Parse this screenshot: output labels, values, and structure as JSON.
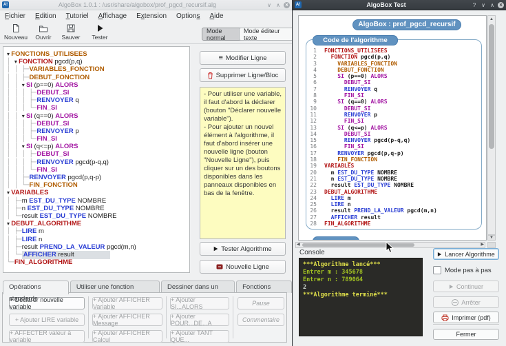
{
  "colors": {
    "kw": {
      "o": "#b05c00",
      "r": "#b21515",
      "p": "#a317a3",
      "b": "#2b3fd4",
      "k": "#1c1c1c"
    },
    "console": {
      "y": "#dede4a",
      "g": "#a3c322",
      "w": "#c4ccc4"
    },
    "badge_blue": "#6092c0",
    "console_bg": "#2a2a27",
    "selection": "#dbdfe3"
  },
  "left_window": {
    "title": "AlgoBox 1.0.1 : /usr/share/algobox/prof_pgcd_recursif.alg",
    "menus": [
      {
        "label": "Fichier",
        "u": 0
      },
      {
        "label": "Edition",
        "u": 0
      },
      {
        "label": "Tutoriel",
        "u": 0
      },
      {
        "label": "Affichage",
        "u": 0
      },
      {
        "label": "Extension",
        "u": 1
      },
      {
        "label": "Options",
        "u": 6
      },
      {
        "label": "Aide",
        "u": 0
      }
    ],
    "toolbar": {
      "items": [
        "Nouveau",
        "Ouvrir",
        "Sauver",
        "Tester"
      ],
      "mode_normal": "Mode normal",
      "mode_editor": "Mode éditeur texte"
    },
    "tree": {
      "items": [
        {
          "pre": "",
          "c": "a",
          "seg": [
            [
              "FONCTIONS_UTILISEES",
              "o"
            ]
          ]
        },
        {
          "pre": "│ ",
          "c": "a",
          "seg": [
            [
              "FONCTION",
              "r"
            ],
            [
              " pgcd(p,q)",
              "k"
            ]
          ]
        },
        {
          "pre": "│ │ ",
          "c": "t",
          "seg": [
            [
              "VARIABLES_FONCTION",
              "o"
            ]
          ]
        },
        {
          "pre": "│ │ ",
          "c": "t",
          "seg": [
            [
              "DEBUT_FONCTION",
              "o"
            ]
          ]
        },
        {
          "pre": "│ │ ",
          "c": "a",
          "seg": [
            [
              "SI",
              "p"
            ],
            [
              " (p==0) ",
              "k"
            ],
            [
              "ALORS",
              "p"
            ]
          ]
        },
        {
          "pre": "│ │ │ ",
          "c": "t",
          "seg": [
            [
              "DEBUT_SI",
              "p"
            ]
          ]
        },
        {
          "pre": "│ │ │ ",
          "c": "t",
          "seg": [
            [
              "RENVOYER",
              "b"
            ],
            [
              " q",
              "k"
            ]
          ]
        },
        {
          "pre": "│ │ │ ",
          "c": "l",
          "seg": [
            [
              "FIN_SI",
              "p"
            ]
          ]
        },
        {
          "pre": "│ │ ",
          "c": "a",
          "seg": [
            [
              "SI",
              "p"
            ],
            [
              " (q==0) ",
              "k"
            ],
            [
              "ALORS",
              "p"
            ]
          ]
        },
        {
          "pre": "│ │ │ ",
          "c": "t",
          "seg": [
            [
              "DEBUT_SI",
              "p"
            ]
          ]
        },
        {
          "pre": "│ │ │ ",
          "c": "t",
          "seg": [
            [
              "RENVOYER",
              "b"
            ],
            [
              " p",
              "k"
            ]
          ]
        },
        {
          "pre": "│ │ │ ",
          "c": "l",
          "seg": [
            [
              "FIN_SI",
              "p"
            ]
          ]
        },
        {
          "pre": "│ │ ",
          "c": "a",
          "seg": [
            [
              "SI",
              "p"
            ],
            [
              " (q<=p) ",
              "k"
            ],
            [
              "ALORS",
              "p"
            ]
          ]
        },
        {
          "pre": "│ │ │ ",
          "c": "t",
          "seg": [
            [
              "DEBUT_SI",
              "p"
            ]
          ]
        },
        {
          "pre": "│ │ │ ",
          "c": "t",
          "seg": [
            [
              "RENVOYER",
              "b"
            ],
            [
              " pgcd(p-q,q)",
              "k"
            ]
          ]
        },
        {
          "pre": "│ │ │ ",
          "c": "l",
          "seg": [
            [
              "FIN_SI",
              "p"
            ]
          ]
        },
        {
          "pre": "│ │ ",
          "c": "t",
          "seg": [
            [
              "RENVOYER",
              "b"
            ],
            [
              " pgcd(p,q-p)",
              "k"
            ]
          ]
        },
        {
          "pre": "│ │ ",
          "c": "l",
          "seg": [
            [
              "FIN_FONCTION",
              "o"
            ]
          ]
        },
        {
          "pre": "",
          "c": "a",
          "seg": [
            [
              "VARIABLES",
              "r"
            ]
          ]
        },
        {
          "pre": "│ ",
          "c": "t",
          "seg": [
            [
              "m ",
              "k"
            ],
            [
              "EST_DU_TYPE",
              "b"
            ],
            [
              " NOMBRE",
              "k"
            ]
          ]
        },
        {
          "pre": "│ ",
          "c": "t",
          "seg": [
            [
              "n ",
              "k"
            ],
            [
              "EST_DU_TYPE",
              "b"
            ],
            [
              " NOMBRE",
              "k"
            ]
          ]
        },
        {
          "pre": "│ ",
          "c": "l",
          "seg": [
            [
              "result ",
              "k"
            ],
            [
              "EST_DU_TYPE",
              "b"
            ],
            [
              " NOMBRE",
              "k"
            ]
          ]
        },
        {
          "pre": "",
          "c": "a",
          "seg": [
            [
              "DEBUT_ALGORITHME",
              "r"
            ]
          ]
        },
        {
          "pre": "│ ",
          "c": "t",
          "seg": [
            [
              "LIRE",
              "b"
            ],
            [
              " m",
              "k"
            ]
          ]
        },
        {
          "pre": "│ ",
          "c": "t",
          "seg": [
            [
              "LIRE",
              "b"
            ],
            [
              " n",
              "k"
            ]
          ]
        },
        {
          "pre": "│ ",
          "c": "t",
          "seg": [
            [
              "result ",
              "k"
            ],
            [
              "PREND_LA_VALEUR",
              "b"
            ],
            [
              " pgcd(m,n)",
              "k"
            ]
          ]
        },
        {
          "pre": "│ ",
          "c": "l",
          "seg": [
            [
              "AFFICHER",
              "b"
            ],
            [
              " result",
              "k"
            ]
          ],
          "sel": true
        },
        {
          "pre": "",
          "c": "l",
          "seg": [
            [
              "FIN_ALGORITHME",
              "r"
            ]
          ]
        }
      ]
    },
    "middle": {
      "modify": "Modifier Ligne",
      "delete": "Supprimer Ligne/Bloc",
      "note": "- Pour utiliser une variable, il faut d'abord la déclarer (bouton \"Déclarer nouvelle variable\").\n- Pour ajouter un nouvel élément à l'algorithme, il faut d'abord insérer une nouvelle ligne (bouton \"Nouvelle Ligne\"), puis cliquer sur un des boutons disponibles dans les panneaux disponibles en bas de la fenêtre.",
      "test": "Tester Algorithme",
      "newline": "Nouvelle Ligne"
    },
    "tabs": [
      "Opérations standards",
      "Utiliser une fonction numérique",
      "Dessiner dans un repère",
      "Fonctions locales"
    ],
    "ops": {
      "col1": [
        "+ Déclarer nouvelle variable",
        "+ Ajouter LIRE variable",
        "+ AFFECTER valeur à variable"
      ],
      "col2": [
        "+ Ajouter AFFICHER Variable",
        "+ Ajouter AFFICHER Message",
        "+ Ajouter AFFICHER Calcul"
      ],
      "col3": [
        "+ Ajouter SI...ALORS",
        "+ Ajouter POUR...DE...A",
        "+ Ajouter TANT QUE..."
      ],
      "col4": [
        "Pause",
        "Commentaire"
      ]
    }
  },
  "right_window": {
    "title": "AlgoBox Test",
    "badge": "AlgoBox : prof_pgcd_recursif",
    "code_badge": "Code de l'algorithme",
    "code": {
      "lines": [
        {
          "n": 1,
          "i": 0,
          "seg": [
            [
              "FONCTIONS_UTILISEES",
              "r"
            ]
          ]
        },
        {
          "n": 2,
          "i": 2,
          "seg": [
            [
              "FONCTION",
              "r"
            ],
            [
              " pgcd(p,q)",
              "k"
            ]
          ]
        },
        {
          "n": 3,
          "i": 4,
          "seg": [
            [
              "VARIABLES_FONCTION",
              "o"
            ]
          ]
        },
        {
          "n": 4,
          "i": 4,
          "seg": [
            [
              "DEBUT_FONCTION",
              "o"
            ]
          ]
        },
        {
          "n": 5,
          "i": 4,
          "seg": [
            [
              "SI",
              "p"
            ],
            [
              " (p==0) ",
              "k"
            ],
            [
              "ALORS",
              "p"
            ]
          ]
        },
        {
          "n": 6,
          "i": 6,
          "seg": [
            [
              "DEBUT_SI",
              "p"
            ]
          ]
        },
        {
          "n": 7,
          "i": 6,
          "seg": [
            [
              "RENVOYER",
              "b"
            ],
            [
              " q",
              "k"
            ]
          ]
        },
        {
          "n": 8,
          "i": 6,
          "seg": [
            [
              "FIN_SI",
              "p"
            ]
          ]
        },
        {
          "n": 9,
          "i": 4,
          "seg": [
            [
              "SI",
              "p"
            ],
            [
              " (q==0) ",
              "k"
            ],
            [
              "ALORS",
              "p"
            ]
          ]
        },
        {
          "n": 10,
          "i": 6,
          "seg": [
            [
              "DEBUT_SI",
              "p"
            ]
          ]
        },
        {
          "n": 11,
          "i": 6,
          "seg": [
            [
              "RENVOYER",
              "b"
            ],
            [
              " p",
              "k"
            ]
          ]
        },
        {
          "n": 12,
          "i": 6,
          "seg": [
            [
              "FIN_SI",
              "p"
            ]
          ]
        },
        {
          "n": 13,
          "i": 4,
          "seg": [
            [
              "SI",
              "p"
            ],
            [
              " (q<=p) ",
              "k"
            ],
            [
              "ALORS",
              "p"
            ]
          ]
        },
        {
          "n": 14,
          "i": 6,
          "seg": [
            [
              "DEBUT_SI",
              "p"
            ]
          ]
        },
        {
          "n": 15,
          "i": 6,
          "seg": [
            [
              "RENVOYER",
              "b"
            ],
            [
              " pgcd(p-q,q)",
              "k"
            ]
          ]
        },
        {
          "n": 16,
          "i": 6,
          "seg": [
            [
              "FIN_SI",
              "p"
            ]
          ]
        },
        {
          "n": 17,
          "i": 4,
          "seg": [
            [
              "RENVOYER",
              "b"
            ],
            [
              " pgcd(p,q-p)",
              "k"
            ]
          ]
        },
        {
          "n": 18,
          "i": 4,
          "seg": [
            [
              "FIN_FONCTION",
              "o"
            ]
          ]
        },
        {
          "n": 19,
          "i": 0,
          "seg": [
            [
              "VARIABLES",
              "r"
            ]
          ]
        },
        {
          "n": 20,
          "i": 2,
          "seg": [
            [
              "m ",
              "k"
            ],
            [
              "EST_DU_TYPE",
              "b"
            ],
            [
              " NOMBRE",
              "k"
            ]
          ]
        },
        {
          "n": 21,
          "i": 2,
          "seg": [
            [
              "n ",
              "k"
            ],
            [
              "EST_DU_TYPE",
              "b"
            ],
            [
              " NOMBRE",
              "k"
            ]
          ]
        },
        {
          "n": 22,
          "i": 2,
          "seg": [
            [
              "result ",
              "k"
            ],
            [
              "EST_DU_TYPE",
              "b"
            ],
            [
              " NOMBRE",
              "k"
            ]
          ]
        },
        {
          "n": 23,
          "i": 0,
          "seg": [
            [
              "DEBUT_ALGORITHME",
              "r"
            ]
          ]
        },
        {
          "n": 24,
          "i": 2,
          "seg": [
            [
              "LIRE",
              "b"
            ],
            [
              " m",
              "k"
            ]
          ]
        },
        {
          "n": 25,
          "i": 2,
          "seg": [
            [
              "LIRE",
              "b"
            ],
            [
              " n",
              "k"
            ]
          ]
        },
        {
          "n": 26,
          "i": 2,
          "seg": [
            [
              "result ",
              "k"
            ],
            [
              "PREND_LA_VALEUR",
              "b"
            ],
            [
              " pgcd(m,n)",
              "k"
            ]
          ]
        },
        {
          "n": 27,
          "i": 2,
          "seg": [
            [
              "AFFICHER",
              "b"
            ],
            [
              " result",
              "k"
            ]
          ]
        },
        {
          "n": 28,
          "i": 0,
          "seg": [
            [
              "FIN_ALGORITHME",
              "r"
            ]
          ]
        }
      ]
    },
    "console_label": "Console",
    "console_lines": [
      {
        "t": "***Algorithme lancé***",
        "c": "y"
      },
      {
        "t": "Entrer m : 345678",
        "c": "g"
      },
      {
        "t": "Entrer n : 789064",
        "c": "g"
      },
      {
        "t": "2",
        "c": "w"
      },
      {
        "t": "***Algorithme terminé***",
        "c": "y"
      }
    ],
    "buttons": {
      "lancer": "Lancer Algorithme",
      "pas_a_pas": "Mode pas à pas",
      "continuer": "Continuer",
      "arreter": "Arrêter",
      "imprimer": "Imprimer (pdf)",
      "fermer": "Fermer"
    }
  }
}
